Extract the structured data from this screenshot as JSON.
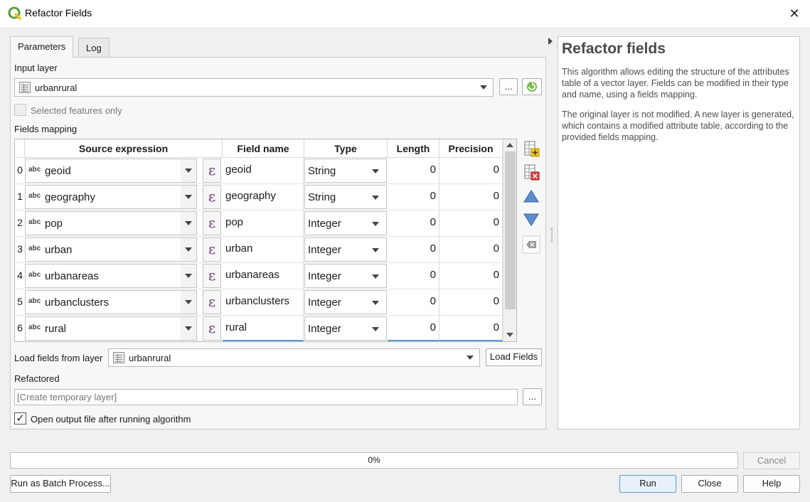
{
  "window": {
    "title": "Refactor Fields"
  },
  "tabs": [
    {
      "label": "Parameters"
    },
    {
      "label": "Log"
    }
  ],
  "input_layer": {
    "label": "Input layer",
    "value": "urbanrural",
    "browse": "..."
  },
  "selected_only": {
    "label": "Selected features only",
    "checked": false
  },
  "fields_mapping": {
    "label": "Fields mapping",
    "columns": [
      "Source expression",
      "Field name",
      "Type",
      "Length",
      "Precision"
    ],
    "rows": [
      {
        "idx": "0",
        "source": "geoid",
        "name": "geoid",
        "type": "String",
        "length": "0",
        "precision": "0"
      },
      {
        "idx": "1",
        "source": "geography",
        "name": "geography",
        "type": "String",
        "length": "0",
        "precision": "0"
      },
      {
        "idx": "2",
        "source": "pop",
        "name": "pop",
        "type": "Integer",
        "length": "0",
        "precision": "0"
      },
      {
        "idx": "3",
        "source": "urban",
        "name": "urban",
        "type": "Integer",
        "length": "0",
        "precision": "0"
      },
      {
        "idx": "4",
        "source": "urbanareas",
        "name": "urbanareas",
        "type": "Integer",
        "length": "0",
        "precision": "0"
      },
      {
        "idx": "5",
        "source": "urbanclusters",
        "name": "urbanclusters",
        "type": "Integer",
        "length": "0",
        "precision": "0"
      },
      {
        "idx": "6",
        "source": "rural",
        "name": "rural",
        "type": "Integer",
        "length": "0",
        "precision": "0"
      }
    ],
    "abc_tag": "abc",
    "epsilon": "ε"
  },
  "load_fields": {
    "label": "Load fields from layer",
    "value": "urbanrural",
    "button": "Load Fields"
  },
  "refactored": {
    "label": "Refactored",
    "placeholder": "[Create temporary layer]",
    "browse": "..."
  },
  "open_output": {
    "label": "Open output file after running algorithm",
    "checked": true
  },
  "help": {
    "title": "Refactor fields",
    "p1": "This algorithm allows editing the structure of the attributes table of a vector layer. Fields can be modified in their type and name, using a fields mapping.",
    "p2": "The original layer is not modified. A new layer is generated, which contains a modified attribute table, according to the provided fields mapping."
  },
  "progress": {
    "text": "0%",
    "value": 0
  },
  "buttons": {
    "cancel": "Cancel",
    "batch": "Run as Batch Process...",
    "run": "Run",
    "close": "Close",
    "help": "Help"
  },
  "colors": {
    "accent": "#5b9bd5",
    "qgis_green": "#5a9e3a",
    "epsilon": "#6b3a7a"
  }
}
